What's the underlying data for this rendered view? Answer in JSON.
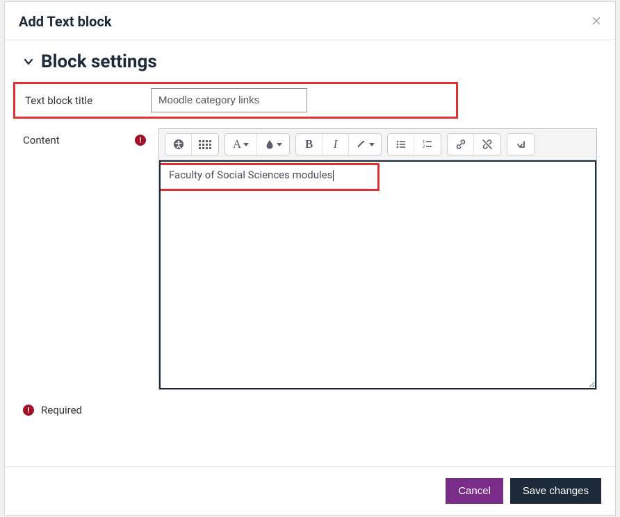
{
  "modal": {
    "title": "Add Text block",
    "close_label": "×"
  },
  "section": {
    "title": "Block settings"
  },
  "fields": {
    "title_label": "Text block title",
    "title_value": "Moodle category links",
    "content_label": "Content",
    "content_value": "Faculty of Social Sciences modules"
  },
  "required_note": "Required",
  "toolbar": {
    "a11y": "accessibility",
    "grid": "character-map",
    "font": "A",
    "color": "color",
    "bold": "B",
    "italic": "I",
    "highlight": "highlight",
    "ul": "bulleted-list",
    "ol": "numbered-list",
    "link": "link",
    "unlink": "unlink",
    "more": "toggle-toolbar"
  },
  "footer": {
    "cancel": "Cancel",
    "save": "Save changes"
  }
}
